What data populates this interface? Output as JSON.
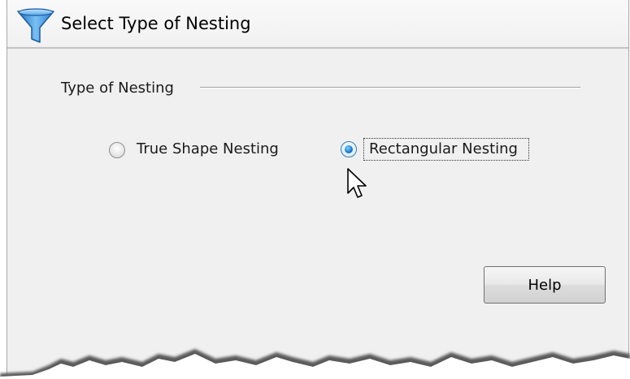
{
  "dialog": {
    "title": "Select Type of Nesting",
    "title_icon": "funnel-icon"
  },
  "nesting_group": {
    "label": "Type of Nesting",
    "options": [
      {
        "label": "True Shape Nesting",
        "selected": false
      },
      {
        "label": "Rectangular Nesting",
        "selected": true
      }
    ]
  },
  "buttons": {
    "help_label": "Help"
  },
  "colors": {
    "dialog_background": "#f0f0f0",
    "funnel_icon": "#3f8fd8",
    "radio_selected": "#1f7fd0"
  }
}
